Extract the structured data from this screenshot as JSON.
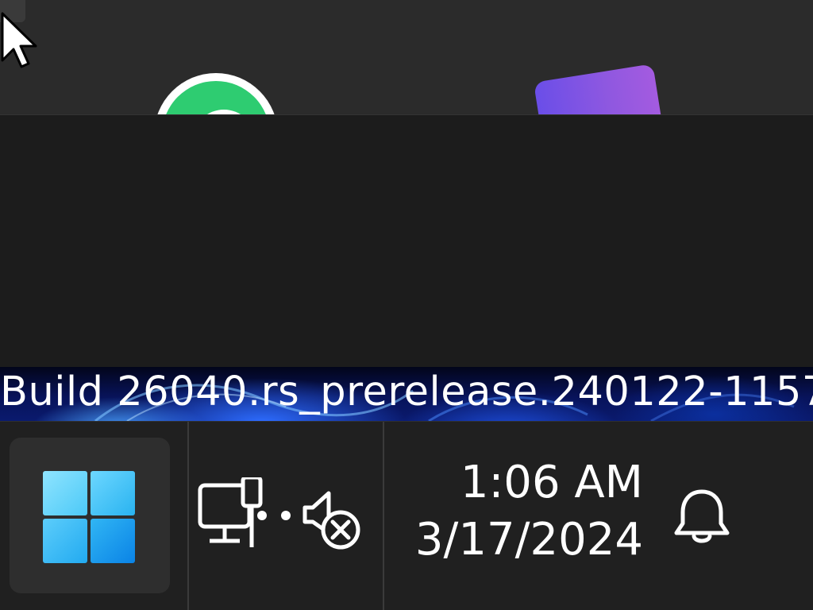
{
  "watermark": {
    "build_text": "Build 26040.rs_prerelease.240122-1157"
  },
  "top_apps": [
    {
      "icon": "whatsapp-icon"
    },
    {
      "icon": "app-icon-purple"
    }
  ],
  "taskbar": {
    "start_icon": "windows-logo-icon",
    "tray_icons": [
      "network-disconnected-icon",
      "volume-muted-icon"
    ],
    "clock": {
      "time": "1:06 AM",
      "date": "3/17/2024"
    },
    "notification_icon": "bell-icon"
  },
  "colors": {
    "taskbar_bg": "#202020",
    "start_button_bg": "#2e2e2e",
    "accent_blue": "#29b3f0",
    "whatsapp_green": "#2ecc71",
    "purple_app": "#8f58e0"
  }
}
